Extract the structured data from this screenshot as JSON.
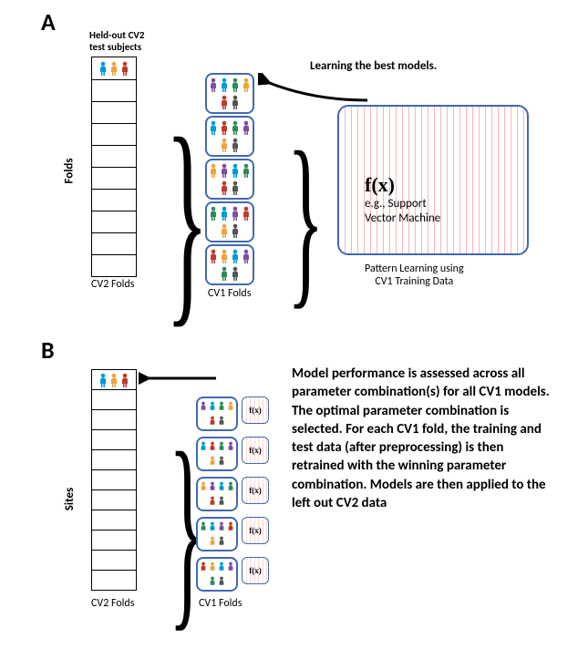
{
  "panelA": {
    "label": "A",
    "heldout_caption": "Held-out CV2\ntest subjects",
    "folds_axis": "Folds",
    "cv2_caption": "CV2 Folds",
    "cv1_caption": "CV1 Folds",
    "learning_label": "Learning the best models.",
    "fx_symbol": "f(x)",
    "fx_example": "e.g., Support\nVector Machine",
    "pattern_caption": "Pattern Learning using\nCV1 Training Data"
  },
  "panelB": {
    "label": "B",
    "sites_axis": "Sites",
    "cv2_caption": "CV2 Folds",
    "cv1_caption": "CV1 Folds",
    "fx_symbol": "f(x)",
    "body": "Model performance is assessed across all parameter combination(s) for all CV1 models. The optimal parameter combination is selected. For each CV1 fold, the training and test data (after preprocessing) is then retrained with the winning parameter combination. Models are then applied to the left out CV2 data"
  },
  "diagram_data": {
    "description": "Nested cross-validation schematic. Panel A: outer CV2 loop with 10 folds; top fold held out; inner CV1 loop with 5 folds trained by pattern-learning model f(x) (e.g. SVM). Panel B: same CV2 column (labelled by Sites, 11 rows); CV1 results with per-fold f(x) models feed the winning model back to the held-out CV2 fold.",
    "panelA": {
      "cv2_fold_count": 10,
      "cv1_fold_count": 5,
      "held_out_index": 0,
      "model": "f(x)",
      "model_example": "Support Vector Machine"
    },
    "panelB": {
      "cv2_row_count": 11,
      "cv1_fold_count": 5,
      "arrow": "CV1 models applied back to held-out CV2 fold"
    }
  },
  "colors": {
    "box_border": "#4169b0",
    "people": [
      "#0099d6",
      "#f1a33c",
      "#c0392b",
      "#7e4ea0",
      "#2e8b57",
      "#555"
    ]
  }
}
